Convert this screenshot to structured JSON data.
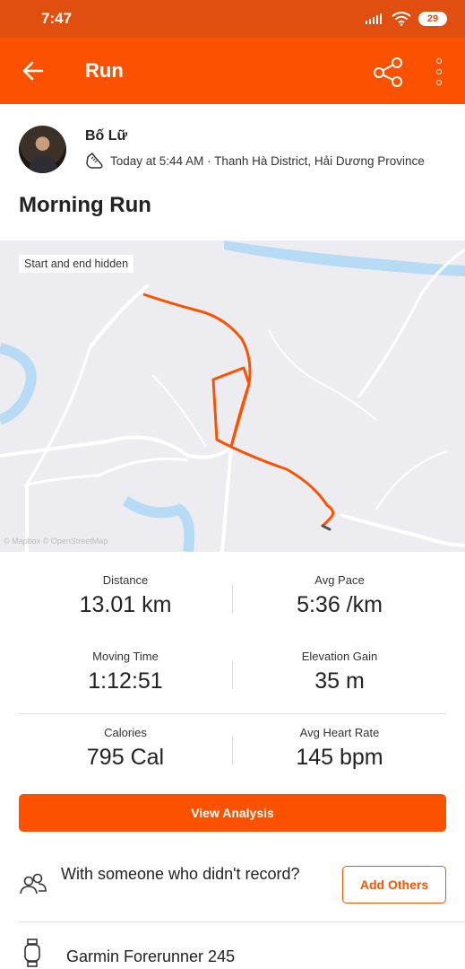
{
  "status_bar": {
    "time": "7:47",
    "battery": "29"
  },
  "app_bar": {
    "title": "Run"
  },
  "athlete": {
    "name": "Bố Lữ",
    "meta": "Today at 5:44 AM · Thanh Hà District, Hải Dương Province"
  },
  "activity": {
    "title": "Morning Run"
  },
  "map": {
    "privacy_label": "Start and end hidden",
    "attribution": "© Mapbox © OpenStreetMap",
    "route_color": "#fc5200"
  },
  "stats": [
    {
      "label": "Distance",
      "value": "13.01 km"
    },
    {
      "label": "Avg Pace",
      "value": "5:36 /km"
    },
    {
      "label": "Moving Time",
      "value": "1:12:51"
    },
    {
      "label": "Elevation Gain",
      "value": "35 m"
    },
    {
      "label": "Calories",
      "value": "795 Cal"
    },
    {
      "label": "Avg Heart Rate",
      "value": "145 bpm"
    }
  ],
  "actions": {
    "view_analysis": "View Analysis",
    "with_text": "With someone who didn't record?",
    "add_others": "Add Others"
  },
  "device": {
    "name": "Garmin Forerunner 245"
  },
  "colors": {
    "brand": "#fc5200",
    "status_bar": "#e14f10"
  }
}
